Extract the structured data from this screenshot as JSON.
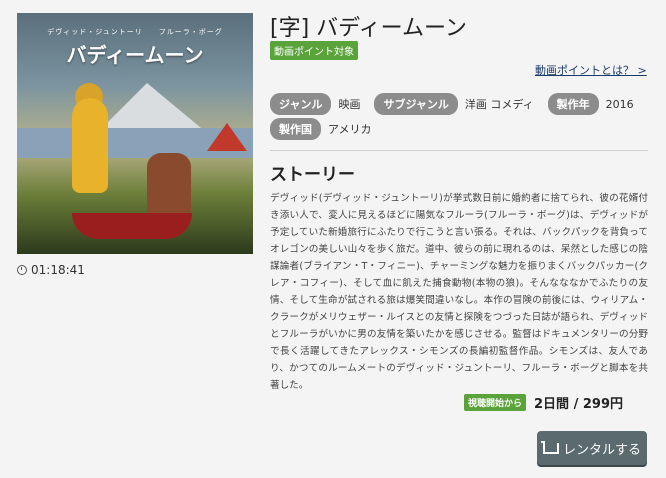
{
  "poster": {
    "credits": "デヴィッド・ジュントーリ　　フルーラ・ボーグ",
    "title": "バディームーン"
  },
  "duration": "01:18:41",
  "title": "[字] バディームーン",
  "point_badge": "動画ポイント対象",
  "point_link": "動画ポイントとは？ >",
  "meta": {
    "genre_label": "ジャンル",
    "genre_value": "映画",
    "subgenre_label": "サブジャンル",
    "subgenre_value": "洋画 コメディ",
    "year_label": "製作年",
    "year_value": "2016",
    "country_label": "製作国",
    "country_value": "アメリカ"
  },
  "story_heading": "ストーリー",
  "story_text": "デヴィッド(デヴィッド・ジュントーリ)が挙式数日前に婚約者に捨てられ、彼の花婿付き添い人で、変人に見えるほどに陽気なフルーラ(フルーラ・ボーグ)は、デヴィッドが予定していた新婚旅行にふたりで行こうと言い張る。それは、バックパックを背負ってオレゴンの美しい山々を歩く旅だ。道中、彼らの前に現れるのは、呆然とした感じの陰謀論者(ブライアン・T・フィニー)、チャーミングな魅力を振りまくバックパッカー(クレア・コフィー)、そして血に飢えた捕食動物(本物の狼)。そんなななかでふたりの友情、そして生命が試される旅は爆笑間違いなし。本作の冒険の前後には、ウィリアム・クラークがメリウェザー・ルイスとの友情と探険をつづった日誌が語られ、デヴィッドとフルーラがいかに男の友情を築いたかを感じさせる。監督はドキュメンタリーの分野で長く活躍してきたアレックス・シモンズの長編初監督作品。シモンズは、友人であり、かつてのルームメートのデヴィッド・ジュントーリ、フルーラ・ボーグと脚本を共著した。",
  "start_badge": "視聴開始から",
  "price": "2日間 / 299円",
  "rent_button": "レンタルする",
  "colors": {
    "accent_green": "#5aa33a",
    "tag_gray": "#8c8c8c",
    "button_bg": "#5a6a6e"
  }
}
